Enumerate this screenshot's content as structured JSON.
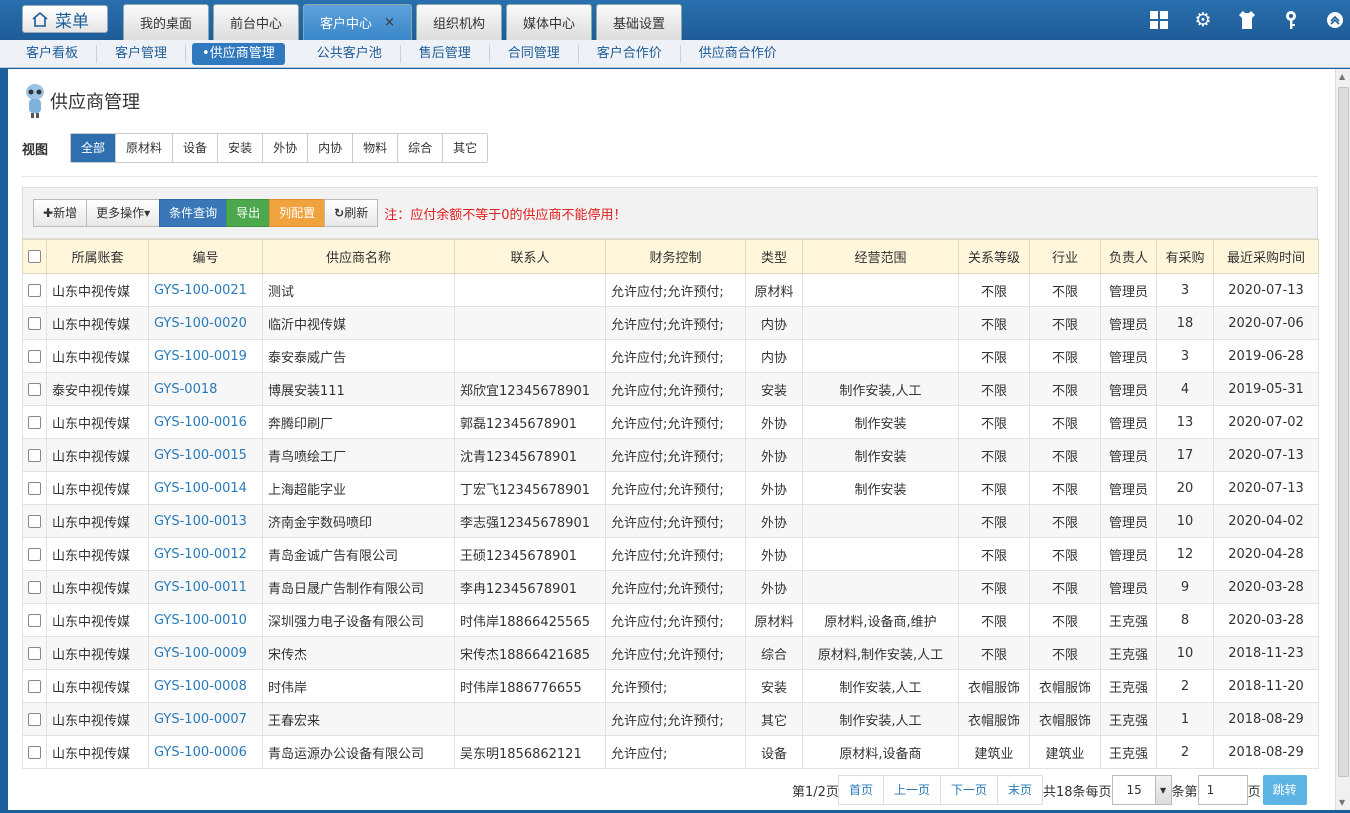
{
  "topbar": {
    "menu_label": "菜单",
    "tabs": [
      {
        "label": "我的桌面"
      },
      {
        "label": "前台中心"
      },
      {
        "label": "客户中心",
        "close": "×"
      },
      {
        "label": "组织机构"
      },
      {
        "label": "媒体中心"
      },
      {
        "label": "基础设置"
      }
    ],
    "icons": [
      "layout-icon",
      "gear-icon",
      "shirt-icon",
      "key-icon",
      "chevron-up-icon"
    ]
  },
  "subnav": {
    "items": [
      "客户看板",
      "客户管理",
      "•供应商管理",
      "公共客户池",
      "售后管理",
      "合同管理",
      "客户合作价",
      "供应商合作价"
    ]
  },
  "page": {
    "title": "供应商管理",
    "view_label": "视图",
    "view_tabs": [
      "全部",
      "原材料",
      "设备",
      "安装",
      "外协",
      "内协",
      "物料",
      "综合",
      "其它"
    ]
  },
  "toolbar": {
    "add": "新增",
    "more": "更多操作▾",
    "query": "条件查询",
    "export": "导出",
    "columns": "列配置",
    "refresh": "刷新",
    "note": "注：应付余额不等于0的供应商不能停用！"
  },
  "table": {
    "headers": [
      "所属账套",
      "编号",
      "供应商名称",
      "联系人",
      "财务控制",
      "类型",
      "经营范围",
      "关系等级",
      "行业",
      "负责人",
      "有采购",
      "最近采购时间"
    ],
    "rows": [
      [
        "山东中视传媒",
        "GYS-100-0021",
        "测试",
        "",
        "允许应付;允许预付;",
        "原材料",
        "",
        "不限",
        "不限",
        "管理员",
        "3",
        "2020-07-13"
      ],
      [
        "山东中视传媒",
        "GYS-100-0020",
        "临沂中视传媒",
        "",
        "允许应付;允许预付;",
        "内协",
        "",
        "不限",
        "不限",
        "管理员",
        "18",
        "2020-07-06"
      ],
      [
        "山东中视传媒",
        "GYS-100-0019",
        "泰安泰威广告",
        "",
        "允许应付;允许预付;",
        "内协",
        "",
        "不限",
        "不限",
        "管理员",
        "3",
        "2019-06-28"
      ],
      [
        "泰安中视传媒",
        "GYS-0018",
        "博展安装111",
        "郑欣宜12345678901",
        "允许应付;允许预付;",
        "安装",
        "制作安装,人工",
        "不限",
        "不限",
        "管理员",
        "4",
        "2019-05-31"
      ],
      [
        "山东中视传媒",
        "GYS-100-0016",
        "奔腾印刷厂",
        "郭磊12345678901",
        "允许应付;允许预付;",
        "外协",
        "制作安装",
        "不限",
        "不限",
        "管理员",
        "13",
        "2020-07-02"
      ],
      [
        "山东中视传媒",
        "GYS-100-0015",
        "青鸟喷绘工厂",
        "沈青12345678901",
        "允许应付;允许预付;",
        "外协",
        "制作安装",
        "不限",
        "不限",
        "管理员",
        "17",
        "2020-07-13"
      ],
      [
        "山东中视传媒",
        "GYS-100-0014",
        "上海超能字业",
        "丁宏飞12345678901",
        "允许应付;允许预付;",
        "外协",
        "制作安装",
        "不限",
        "不限",
        "管理员",
        "20",
        "2020-07-13"
      ],
      [
        "山东中视传媒",
        "GYS-100-0013",
        "济南金宇数码喷印",
        "李志强12345678901",
        "允许应付;允许预付;",
        "外协",
        "",
        "不限",
        "不限",
        "管理员",
        "10",
        "2020-04-02"
      ],
      [
        "山东中视传媒",
        "GYS-100-0012",
        "青岛金诚广告有限公司",
        "王硕12345678901",
        "允许应付;允许预付;",
        "外协",
        "",
        "不限",
        "不限",
        "管理员",
        "12",
        "2020-04-28"
      ],
      [
        "山东中视传媒",
        "GYS-100-0011",
        "青岛日晟广告制作有限公司",
        "李冉12345678901",
        "允许应付;允许预付;",
        "外协",
        "",
        "不限",
        "不限",
        "管理员",
        "9",
        "2020-03-28"
      ],
      [
        "山东中视传媒",
        "GYS-100-0010",
        "深圳强力电子设备有限公司",
        "时伟岸18866425565",
        "允许应付;允许预付;",
        "原材料",
        "原材料,设备商,维护",
        "不限",
        "不限",
        "王克强",
        "8",
        "2020-03-28"
      ],
      [
        "山东中视传媒",
        "GYS-100-0009",
        "宋传杰",
        "宋传杰18866421685",
        "允许应付;允许预付;",
        "综合",
        "原材料,制作安装,人工",
        "不限",
        "不限",
        "王克强",
        "10",
        "2018-11-23"
      ],
      [
        "山东中视传媒",
        "GYS-100-0008",
        "时伟岸",
        "时伟岸1886776655",
        "允许预付;",
        "安装",
        "制作安装,人工",
        "衣帽服饰",
        "衣帽服饰",
        "王克强",
        "2",
        "2018-11-20"
      ],
      [
        "山东中视传媒",
        "GYS-100-0007",
        "王春宏来",
        "",
        "允许应付;允许预付;",
        "其它",
        "制作安装,人工",
        "衣帽服饰",
        "衣帽服饰",
        "王克强",
        "1",
        "2018-08-29"
      ],
      [
        "山东中视传媒",
        "GYS-100-0006",
        "青岛运源办公设备有限公司",
        "吴东明1856862121",
        "允许应付;",
        "设备",
        "原材料,设备商",
        "建筑业",
        "建筑业",
        "王克强",
        "2",
        "2018-08-29"
      ]
    ]
  },
  "pager": {
    "page_info": "第1/2页",
    "first": "首页",
    "prev": "上一页",
    "next": "下一页",
    "last": "末页",
    "total": "共18条每页",
    "page_size": "15",
    "items_label": "条第",
    "page_input": "1",
    "page_suffix": "页",
    "go": "跳转"
  }
}
